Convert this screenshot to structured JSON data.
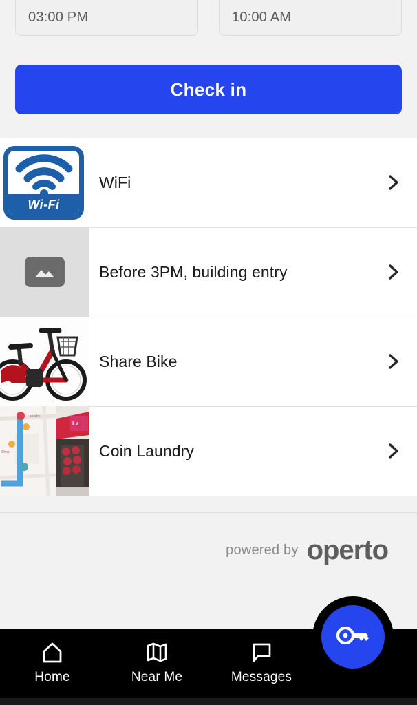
{
  "checkin_form": {
    "check_in_time": "03:00 PM",
    "check_out_time": "10:00 AM",
    "submit_label": "Check in"
  },
  "guides": {
    "items": [
      {
        "label": "WiFi",
        "thumb": "wifi-badge-image",
        "chevron": "chevron-right-icon",
        "badge_text": "Wi-Fi"
      },
      {
        "label": "Before 3PM, building entry",
        "thumb": "image-placeholder",
        "chevron": "chevron-right-icon"
      },
      {
        "label": "Share Bike",
        "thumb": "share-bike-photo",
        "chevron": "chevron-right-icon"
      },
      {
        "label": "Coin Laundry",
        "thumb": "coin-laundry-photo",
        "chevron": "chevron-right-icon"
      }
    ]
  },
  "footer": {
    "powered_by": "powered by",
    "brand": "operto"
  },
  "bottom_nav": {
    "items": [
      {
        "label": "Home",
        "icon": "home-icon"
      },
      {
        "label": "Near Me",
        "icon": "map-icon"
      },
      {
        "label": "Messages",
        "icon": "chat-bubble-icon"
      }
    ],
    "fab_icon": "key-icon"
  },
  "colors": {
    "accent": "#2545ee",
    "page_bg": "#f2f2f2",
    "nav_bg": "#000000",
    "wifi_blue": "#1d5fa8"
  }
}
